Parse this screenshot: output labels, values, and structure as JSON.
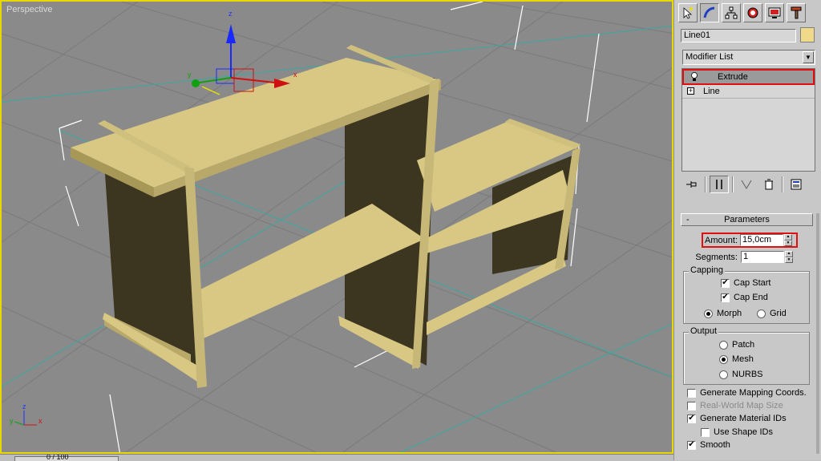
{
  "viewport": {
    "label": "Perspective",
    "gizmo": {
      "x": "x",
      "y": "y",
      "z": "z"
    },
    "corner_axes": {
      "x": "x",
      "y": "y",
      "z": "z"
    }
  },
  "statusbar": {
    "frame": "0 / 100"
  },
  "command_panel": {
    "tabs": [
      "create-icon",
      "modify-icon",
      "hierarchy-icon",
      "motion-icon",
      "display-icon",
      "utilities-icon"
    ],
    "object_name": "Line01",
    "object_color": "#f0da8a",
    "modifier_list_label": "Modifier List",
    "stack": [
      {
        "label": "Extrude",
        "selected": true
      },
      {
        "label": "Line",
        "selected": false
      }
    ]
  },
  "parameters": {
    "title": "Parameters",
    "amount_label": "Amount:",
    "amount_value": "15,0cm",
    "segments_label": "Segments:",
    "segments_value": "1",
    "capping": {
      "title": "Capping",
      "cap_start": "Cap Start",
      "cap_end": "Cap End",
      "morph": "Morph",
      "grid": "Grid"
    },
    "output": {
      "title": "Output",
      "patch": "Patch",
      "mesh": "Mesh",
      "nurbs": "NURBS"
    },
    "gen_mapping": "Generate Mapping Coords.",
    "real_world": "Real-World Map Size",
    "gen_material": "Generate Material IDs",
    "use_shape": "Use Shape IDs",
    "smooth": "Smooth"
  }
}
